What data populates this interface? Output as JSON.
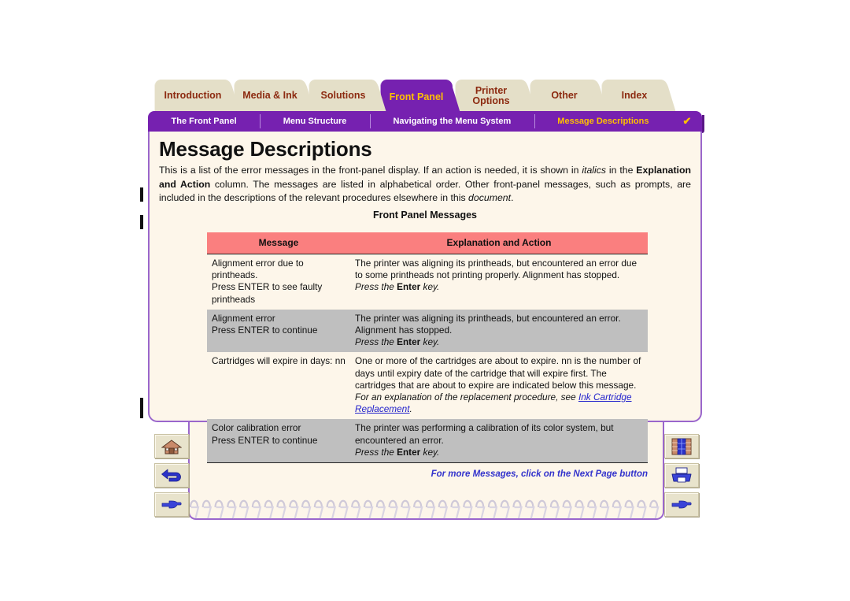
{
  "tabs": [
    {
      "label": "Introduction",
      "active": false
    },
    {
      "label": "Media & Ink",
      "active": false
    },
    {
      "label": "Solutions",
      "active": false
    },
    {
      "label": "Front Panel",
      "active": true
    },
    {
      "label": "Printer\nOptions",
      "active": false
    },
    {
      "label": "Other",
      "active": false
    },
    {
      "label": "Index",
      "active": false
    }
  ],
  "subnav": {
    "items": [
      {
        "label": "The Front Panel",
        "current": false
      },
      {
        "label": "Menu Structure",
        "current": false
      },
      {
        "label": "Navigating the Menu System",
        "current": false
      },
      {
        "label": "Message Descriptions",
        "current": true
      }
    ],
    "check_glyph": "✔"
  },
  "page": {
    "title": "Message Descriptions",
    "intro_part1": "This is a list of the error messages in the front-panel display. If an action is needed, it is shown in ",
    "intro_italic1": "italics",
    "intro_part2": " in the ",
    "intro_bold1": "Explanation and Action",
    "intro_part3": " column. The messages are listed in alphabetical order. Other front-panel messages, such as prompts, are included in the descriptions of the relevant procedures elsewhere in this ",
    "intro_italic2": "document",
    "intro_part4": ".",
    "table_caption": "Front Panel Messages",
    "footnote": "For more Messages, click on the Next Page button"
  },
  "table": {
    "headers": [
      "Message",
      "Explanation and Action"
    ],
    "rows": [
      {
        "shaded": false,
        "message": "Alignment error due to printheads.\nPress ENTER to see faulty printheads",
        "explanation": "The printer was aligning its printheads, but encountered an error due to some printheads not printing properly. Alignment has stopped.",
        "action_pre": "Press the ",
        "action_bold": "Enter",
        "action_post": " key."
      },
      {
        "shaded": true,
        "message": "Alignment error\nPress ENTER to continue",
        "explanation": "The printer was aligning its printheads, but encountered an error. Alignment has stopped.",
        "action_pre": "Press the ",
        "action_bold": "Enter",
        "action_post": " key."
      },
      {
        "shaded": false,
        "message": "Cartridges will expire in days: nn",
        "explanation": "One or more of the cartridges are about to expire. nn is the number of days until expiry date of the cartridge that will expire first. The cartridges that are about to expire are indicated below this message.",
        "action_pre": "For an explanation of the replacement procedure, see ",
        "action_link": "Ink Cartridge Replacement",
        "action_post": "."
      },
      {
        "shaded": true,
        "message": "Color calibration error\nPress ENTER to continue",
        "explanation": "The printer was performing a calibration of its color system, but encountered an error.",
        "action_pre": "Press the ",
        "action_bold": "Enter",
        "action_post": " key."
      }
    ]
  },
  "nav": {
    "left": [
      {
        "name": "home-button",
        "icon": "house-icon"
      },
      {
        "name": "back-button",
        "icon": "back-arrow-icon"
      },
      {
        "name": "next-page-button",
        "icon": "pointing-hand-right-icon"
      }
    ],
    "right": [
      {
        "name": "bookshelf-button",
        "icon": "bookcase-icon"
      },
      {
        "name": "print-button",
        "icon": "printer-icon"
      },
      {
        "name": "forward-button",
        "icon": "pointing-hand-right-icon"
      }
    ]
  },
  "colors": {
    "tab_bg": "#e4dfc8",
    "tab_text": "#8c2a10",
    "active_tab_bg": "#7621b0",
    "active_tab_text": "#ffc000",
    "panel_bg": "#fdf6ea",
    "panel_border": "#9a66cc",
    "table_header_bg": "#fa7f7f",
    "row_shaded_bg": "#bfbfbf",
    "link": "#2222cc",
    "footnote": "#3333cc"
  }
}
